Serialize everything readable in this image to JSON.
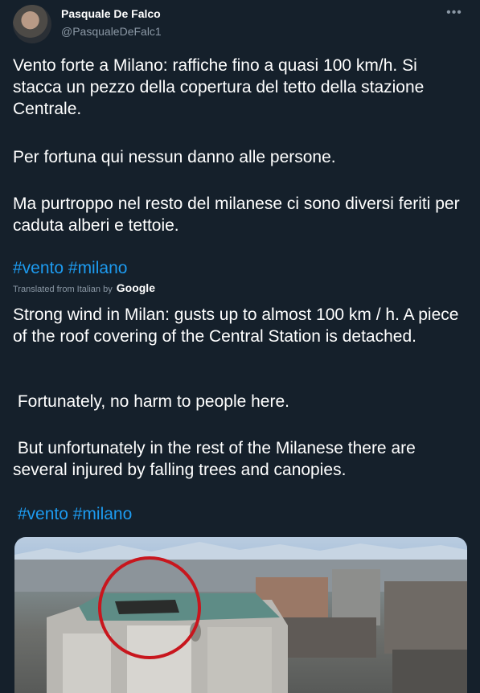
{
  "author": {
    "display_name": "Pasquale De Falco",
    "handle": "@PasqualeDeFalc1",
    "avatar_icon": "avatar-photo"
  },
  "more_menu_icon": "more-dots-icon",
  "original": {
    "paragraph1": "Vento forte a Milano: raffiche fino a quasi 100 km/h. Si stacca un pezzo della copertura del tetto della stazione Centrale.",
    "paragraph2": "Per fortuna qui nessun danno alle persone.",
    "paragraph3": "Ma purtroppo nel resto del milanese ci sono diversi feriti per caduta alberi e tettoie.",
    "hashtags": "#vento #milano"
  },
  "translation": {
    "label": "Translated from Italian by",
    "provider": "Google",
    "paragraph1": "Strong wind in Milan: gusts up to almost 100 km / h. A piece of the roof covering of the Central Station is detached.",
    "paragraph2": " Fortunately, no harm to people here.",
    "paragraph3": " But unfortunately in the rest of the Milanese there are several injured by falling trees and canopies.",
    "hashtags": " #vento #milano"
  },
  "colors": {
    "background": "#15202b",
    "text": "#ffffff",
    "secondary": "#8b98a5",
    "link": "#1d9bf0",
    "highlight_circle": "#c8161d"
  }
}
